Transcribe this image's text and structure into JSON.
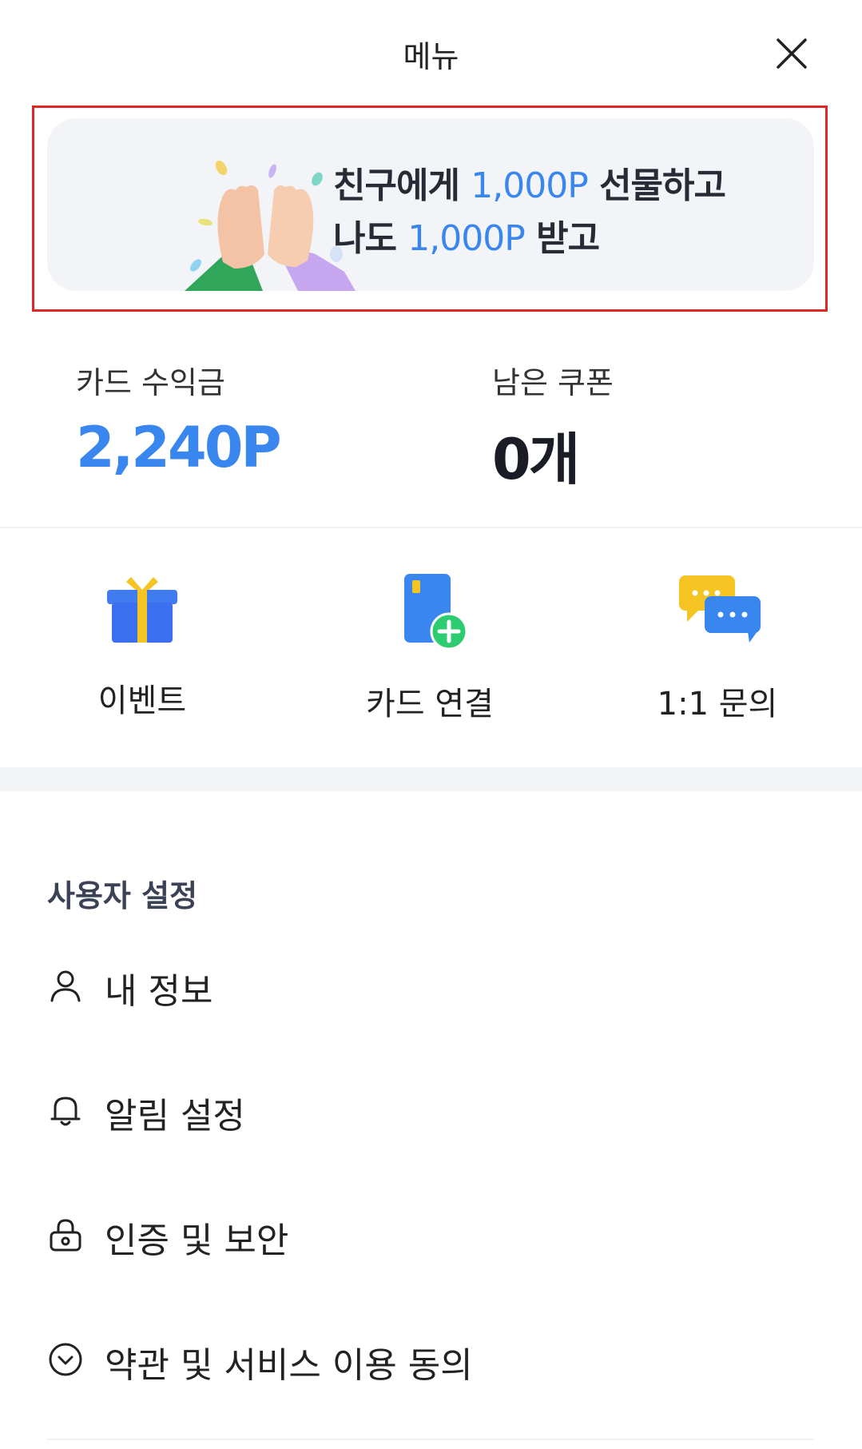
{
  "header": {
    "title": "메뉴"
  },
  "banner": {
    "line1_prefix": "친구에게 ",
    "line1_points": "1,000P",
    "line1_suffix": " 선물하고",
    "line2_prefix": "나도 ",
    "line2_points": "1,000P",
    "line2_suffix": " 받고"
  },
  "stats": [
    {
      "label": "카드 수익금",
      "value": "2,240P"
    },
    {
      "label": "남은 쿠폰",
      "value": "0개"
    }
  ],
  "quick_actions": [
    {
      "label": "이벤트",
      "icon": "gift-icon"
    },
    {
      "label": "카드 연결",
      "icon": "card-add-icon"
    },
    {
      "label": "1:1 문의",
      "icon": "chat-bubbles-icon"
    }
  ],
  "user_settings": {
    "title": "사용자 설정",
    "items": [
      {
        "label": "내 정보",
        "icon": "person-icon"
      },
      {
        "label": "알림 설정",
        "icon": "bell-icon"
      },
      {
        "label": "인증 및 보안",
        "icon": "lock-icon"
      },
      {
        "label": "약관 및 서비스 이용 동의",
        "icon": "chevron-circle-icon"
      }
    ]
  },
  "colors": {
    "accent": "#3a86ef",
    "highlight_border": "#e02525",
    "banner_bg": "#f3f4f7"
  }
}
